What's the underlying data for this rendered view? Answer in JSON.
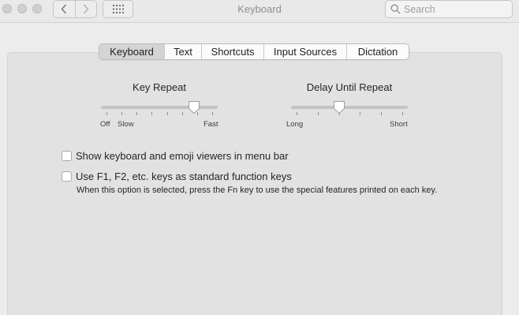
{
  "window": {
    "title": "Keyboard"
  },
  "toolbar": {
    "search_placeholder": "Search"
  },
  "tabs": [
    {
      "label": "Keyboard",
      "active": true
    },
    {
      "label": "Text",
      "active": false
    },
    {
      "label": "Shortcuts",
      "active": false
    },
    {
      "label": "Input Sources",
      "active": false
    },
    {
      "label": "Dictation",
      "active": false
    }
  ],
  "key_repeat": {
    "title": "Key Repeat",
    "label_off": "Off",
    "label_slow": "Slow",
    "label_fast": "Fast",
    "value_fraction": 0.83
  },
  "delay_until_repeat": {
    "title": "Delay Until Repeat",
    "label_long": "Long",
    "label_short": "Short",
    "value_fraction": 0.4
  },
  "options": {
    "show_viewers": {
      "label": "Show keyboard and emoji viewers in menu bar",
      "checked": false
    },
    "function_keys": {
      "label": "Use F1, F2, etc. keys as standard function keys",
      "checked": false,
      "help": "When this option is selected, press the Fn key to use the special features printed on each key."
    }
  }
}
